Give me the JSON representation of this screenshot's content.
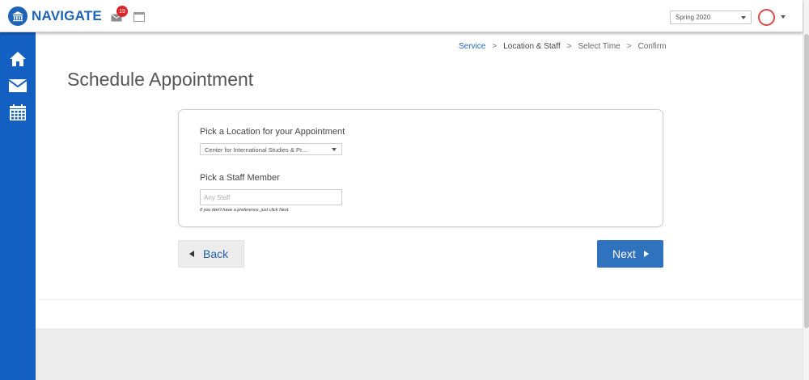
{
  "header": {
    "brand": "NAVIGATE",
    "notification_count": "19",
    "term": {
      "selected": "Spring 2020"
    }
  },
  "sidebar": {
    "items": [
      {
        "name": "home",
        "icon": "home-icon"
      },
      {
        "name": "messages",
        "icon": "mail-icon"
      },
      {
        "name": "calendar",
        "icon": "calendar-icon"
      }
    ]
  },
  "breadcrumb": {
    "steps": [
      {
        "label": "Service"
      },
      {
        "label": "Location & Staff"
      },
      {
        "label": "Select Time"
      },
      {
        "label": "Confirm"
      }
    ],
    "separator": ">"
  },
  "page": {
    "title": "Schedule Appointment"
  },
  "form": {
    "location_label": "Pick a Location for your Appointment",
    "location_value": "Center for International Studies & Pr...",
    "staff_label": "Pick a Staff Member",
    "staff_placeholder": "Any Staff",
    "staff_value": "",
    "staff_hint": "If you don't have a preference, just click Next."
  },
  "actions": {
    "back_label": "Back",
    "next_label": "Next"
  },
  "colors": {
    "brand_blue": "#1460c2",
    "link_blue": "#1e63b5",
    "primary_button": "#2f72be",
    "badge_red": "#d9262c"
  }
}
